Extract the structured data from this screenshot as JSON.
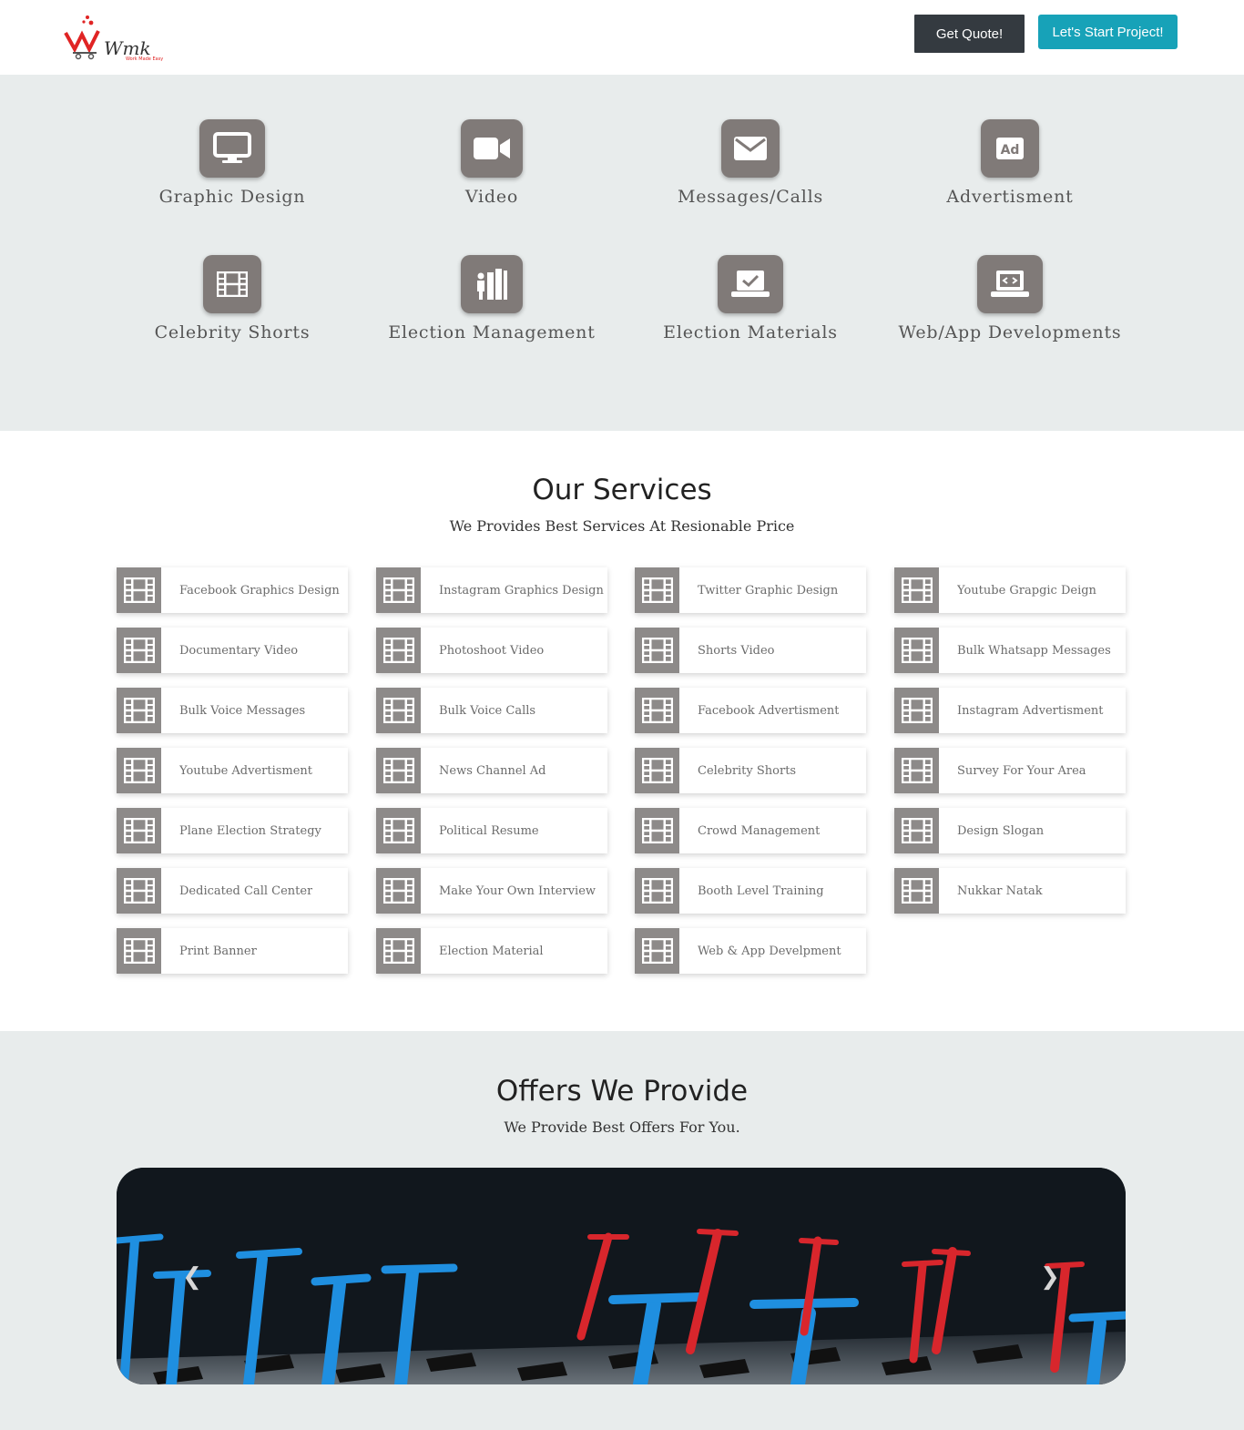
{
  "header": {
    "logo_text": "Wmk",
    "logo_tagline": "Work Made Easy",
    "quote_button": "Get Quote!",
    "start_button": "Let's Start Project!"
  },
  "categories": [
    {
      "label": "Graphic Design",
      "icon": "monitor-icon"
    },
    {
      "label": "Video",
      "icon": "video-camera-icon"
    },
    {
      "label": "Messages/Calls",
      "icon": "envelope-icon"
    },
    {
      "label": "Advertisment",
      "icon": "ad-icon"
    },
    {
      "label": "Celebrity Shorts",
      "icon": "film-icon"
    },
    {
      "label": "Election Management",
      "icon": "ballot-box-icon"
    },
    {
      "label": "Election Materials",
      "icon": "laptop-check-icon"
    },
    {
      "label": "Web/App Developments",
      "icon": "laptop-code-icon"
    }
  ],
  "services": {
    "title": "Our Services",
    "subtitle": "We Provides Best Services At Resionable Price",
    "items": [
      "Facebook Graphics Design",
      "Instagram Graphics Design",
      "Twitter Graphic Design",
      "Youtube Grapgic Deign",
      "Documentary Video",
      "Photoshoot Video",
      "Shorts Video",
      "Bulk Whatsapp Messages",
      "Bulk Voice Messages",
      "Bulk Voice Calls",
      "Facebook Advertisment",
      "Instagram Advertisment",
      "Youtube Advertisment",
      "News Channel Ad",
      "Celebrity Shorts",
      "Survey For Your Area",
      "Plane Election Strategy",
      "Political Resume",
      "Crowd Management",
      "Design Slogan",
      "Dedicated Call Center",
      "Make Your Own Interview",
      "Booth Level Training",
      "Nukkar Natak",
      "Print Banner",
      "Election Material",
      "Web & App Develpment"
    ]
  },
  "offers": {
    "title": "Offers We Provide",
    "subtitle": "We Provide Best Offers For You.",
    "prev_icon": "chevron-left-icon",
    "next_icon": "chevron-right-icon"
  },
  "colors": {
    "dark_button": "#343a40",
    "accent": "#17a2b8",
    "icon_bg": "#807a78",
    "band_bg": "#e8ecec"
  }
}
